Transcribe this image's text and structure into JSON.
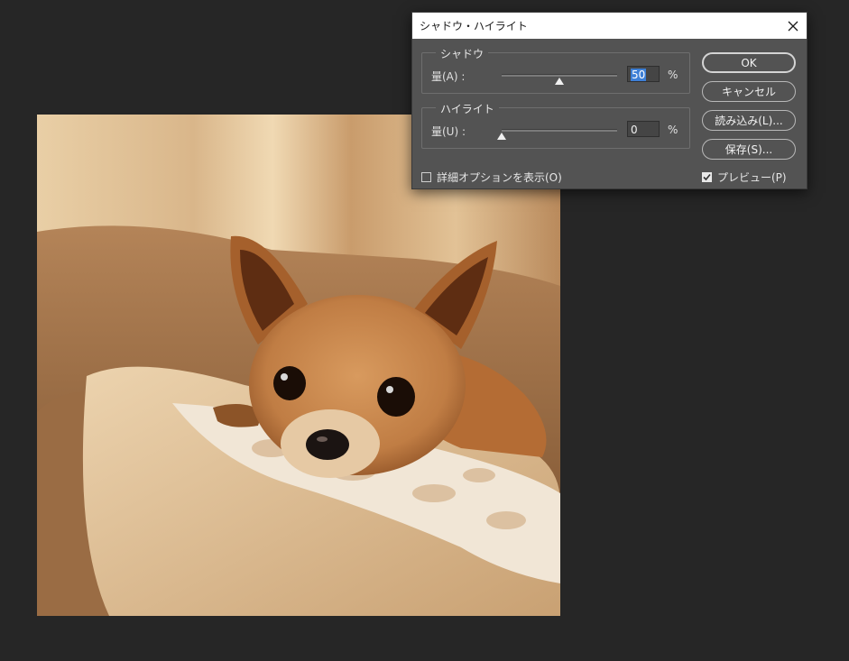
{
  "dialog": {
    "title": "シャドウ・ハイライト",
    "close_icon": "close-icon",
    "shadow": {
      "legend": "シャドウ",
      "amount_label": "量(A) :",
      "amount_value": "50",
      "amount_fraction": 0.5,
      "unit": "%"
    },
    "highlight": {
      "legend": "ハイライト",
      "amount_label": "量(U) :",
      "amount_value": "0",
      "amount_fraction": 0.0,
      "unit": "%"
    },
    "buttons": {
      "ok": "OK",
      "cancel": "キャンセル",
      "load": "読み込み(L)...",
      "save": "保存(S)..."
    },
    "show_more_options": {
      "label": "詳細オプションを表示(O)",
      "checked": false
    },
    "preview": {
      "label": "プレビュー(P)",
      "checked": true
    }
  },
  "colors": {
    "workspace": "#262626",
    "dialog_bg": "#535353",
    "selection": "#3d7fd6"
  }
}
